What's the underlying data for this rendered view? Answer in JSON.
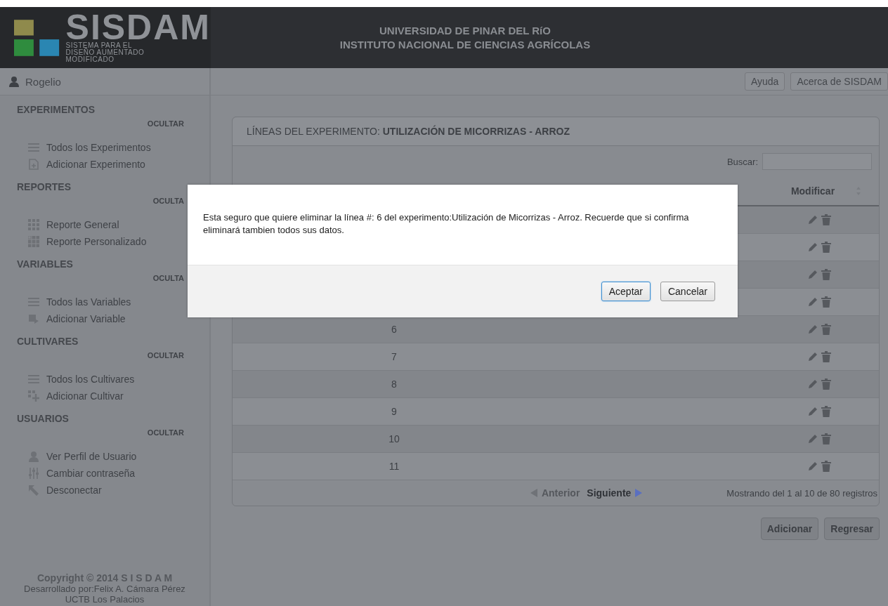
{
  "header": {
    "logo": {
      "title": "SISDAM",
      "subtitle_lines": [
        "SISTEMA PARA EL",
        "DISEÑO AUMENTADO",
        "MODIFICADO"
      ]
    },
    "institution_lines": [
      "UNIVERSIDAD DE PINAR DEL RíO",
      "INSTITUTO NACIONAL DE CIENCIAS AGRÍCOLAS"
    ]
  },
  "user_bar": {
    "user": "Rogelio",
    "buttons": [
      "Ayuda",
      "Acerca de SISDAM"
    ]
  },
  "sidebar": {
    "sections": [
      {
        "title": "EXPERIMENTOS",
        "toggle": "OCULTAR",
        "items": [
          {
            "label": "Todos los Experimentos",
            "kind": "list"
          },
          {
            "label": "Adicionar Experimento",
            "kind": "add-document"
          }
        ]
      },
      {
        "title": "REPORTES",
        "toggle": "OCULTA",
        "items": [
          {
            "label": "Reporte General",
            "kind": "report"
          },
          {
            "label": "Reporte Personalizado",
            "kind": "custom-report"
          }
        ]
      },
      {
        "title": "VARIABLES",
        "toggle": "OCULTA",
        "items": [
          {
            "label": "Todos las Variables",
            "kind": "list"
          },
          {
            "label": "Adicionar Variable",
            "kind": "add-variable"
          }
        ]
      },
      {
        "title": "CULTIVARES",
        "toggle": "OCULTAR",
        "items": [
          {
            "label": "Todos los Cultivares",
            "kind": "list"
          },
          {
            "label": "Adicionar Cultivar",
            "kind": "add-cultivar"
          }
        ]
      },
      {
        "title": "USUARIOS",
        "toggle": "OCULTAR",
        "items": [
          {
            "label": "Ver Perfil de Usuario",
            "kind": "profile"
          },
          {
            "label": "Cambiar contraseña",
            "kind": "password"
          },
          {
            "label": "Desconectar",
            "kind": "logout"
          }
        ]
      }
    ],
    "footer": {
      "copyright": "Copyright © 2014 S I S D A M",
      "credit": "Desarrollado por:Felix A. Cámara Pérez",
      "org": "UCTB Los Palacios"
    }
  },
  "panel": {
    "title": "LÍNEAS DEL EXPERIMENTO: **UTILIZACIÓN DE MICORRIZAS - ARROZ**",
    "search": {
      "label": "Buscar:"
    },
    "table": {
      "columns": [
        {
          "label": "Modificar",
          "sortable": true
        }
      ],
      "rows": [
        {
          "kind": "covered"
        },
        {
          "kind": "covered"
        },
        {
          "kind": "covered"
        },
        {
          "kind": "covered"
        },
        {
          "kind": "numbered",
          "number": "6"
        },
        {
          "kind": "numbered",
          "number": "7"
        },
        {
          "kind": "numbered",
          "number": "8"
        },
        {
          "kind": "numbered",
          "number": "9"
        },
        {
          "kind": "numbered",
          "number": "10"
        },
        {
          "kind": "numbered",
          "number": "11"
        }
      ]
    },
    "pagination": {
      "previous": {
        "label": "Anterior",
        "disabled": true
      },
      "next": {
        "label": "Siguiente",
        "disabled": false
      },
      "info": "Mostrando del 1 al 10 de 80 registros"
    },
    "buttons": [
      "Adicionar",
      "Regresar"
    ]
  },
  "dialog": {
    "message": "Esta seguro que quiere eliminar la línea #: 6 del experimento:Utilización de Micorrizas - Arroz. Recuerde que si confirma eliminará tambien todos sus  datos.",
    "buttons": [
      {
        "label": "Aceptar",
        "selected": true
      },
      {
        "label": "Cancelar",
        "selected": false
      }
    ]
  }
}
